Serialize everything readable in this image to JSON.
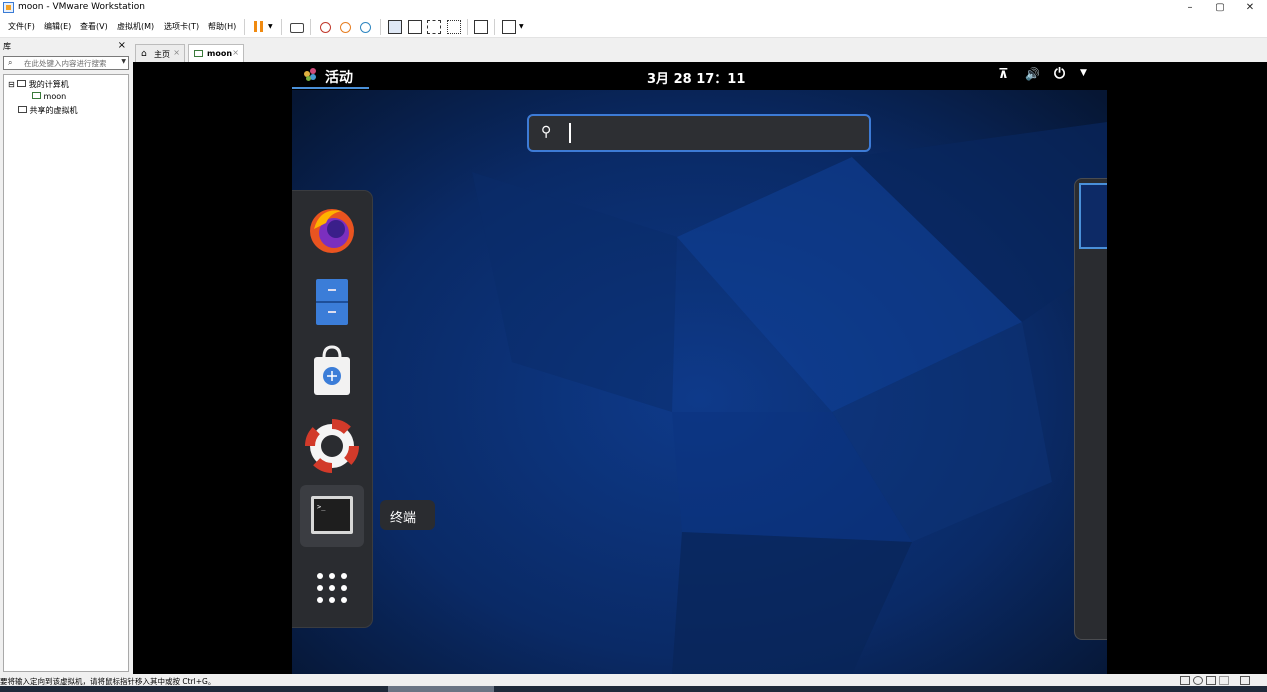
{
  "window": {
    "title": "moon - VMware Workstation",
    "min_glyph": "–",
    "max_glyph": "▢",
    "close_glyph": "✕"
  },
  "menu": [
    "文件(F)",
    "编辑(E)",
    "查看(V)",
    "虚拟机(M)",
    "选项卡(T)",
    "帮助(H)"
  ],
  "toolbar": {
    "icons": [
      "pause-icon",
      "send-keys-icon",
      "snapshot-icon",
      "revert-snapshot-icon",
      "snapshot-manager-icon",
      "show-library-icon",
      "thumbnail-bar-icon",
      "fullscreen-icon",
      "unity-icon",
      "console-view-icon",
      "stretch-guest-icon"
    ]
  },
  "library": {
    "title": "库",
    "close": "×",
    "search_placeholder": "在此处键入内容进行搜索",
    "tree": [
      {
        "label": "我的计算机",
        "expander": "⊟"
      },
      {
        "label": "moon"
      },
      {
        "label": "共享的虚拟机"
      }
    ]
  },
  "tabs": [
    {
      "label": "主页",
      "close": "×"
    },
    {
      "label": "moon",
      "close": "×"
    }
  ],
  "guest": {
    "activities": "活动",
    "clock": "3月 28  17：11",
    "tray_icons": [
      "network-icon",
      "volume-icon",
      "power-icon",
      "dropdown-arrow-icon"
    ],
    "search_value": "",
    "dash_apps": [
      "firefox-icon",
      "files-icon",
      "software-icon",
      "help-icon",
      "terminal-icon",
      "show-apps-icon"
    ],
    "tooltip": "终端"
  },
  "status": {
    "text": "要将输入定向到该虚拟机，请将鼠标指针移入其中或按 Ctrl+G。"
  },
  "colors": {
    "accent": "#4a90d9",
    "desktop": "#0a1a3a",
    "dash": "#2a2c30"
  }
}
